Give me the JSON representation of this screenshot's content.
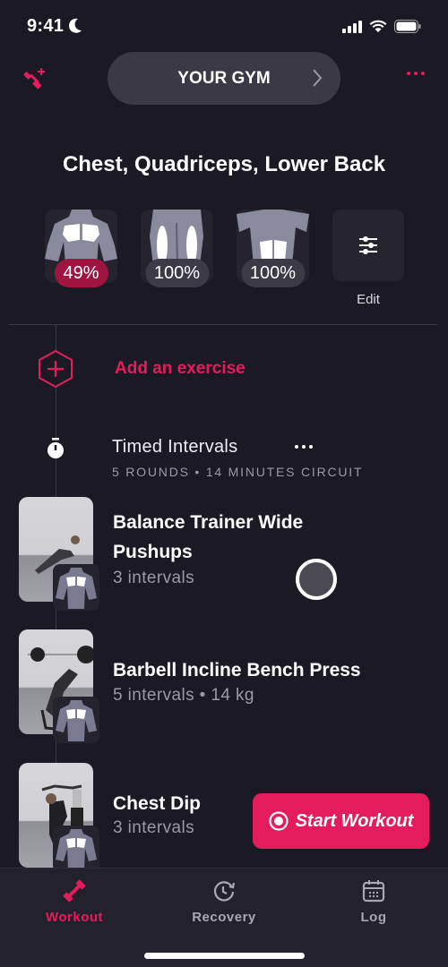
{
  "status_bar": {
    "time": "9:41"
  },
  "header": {
    "gym_label": "YOUR GYM"
  },
  "muscles": {
    "title": "Chest, Quadriceps, Lower Back",
    "items": [
      {
        "name": "Chest",
        "recovery": "49%"
      },
      {
        "name": "Quadriceps",
        "recovery": "100%"
      },
      {
        "name": "Lower Back",
        "recovery": "100%"
      }
    ],
    "edit_label": "Edit"
  },
  "add_exercise_label": "Add an exercise",
  "timed_intervals": {
    "title": "Timed Intervals",
    "subtitle": "5 ROUNDS • 14 MINUTES CIRCUIT"
  },
  "exercises": [
    {
      "name_line1": "Balance Trainer Wide",
      "name_line2": "Pushups",
      "detail": "3 intervals"
    },
    {
      "name": "Barbell Incline Bench Press",
      "detail": "5 intervals • 14 kg"
    },
    {
      "name": "Chest Dip",
      "detail": "3 intervals"
    }
  ],
  "start_workout_label": "Start Workout",
  "tabs": [
    {
      "label": "Workout",
      "active": true
    },
    {
      "label": "Recovery",
      "active": false
    },
    {
      "label": "Log",
      "active": false
    }
  ],
  "colors": {
    "accent": "#e41c5c",
    "background": "#1b1a24",
    "low_recovery": "#a0153f"
  }
}
